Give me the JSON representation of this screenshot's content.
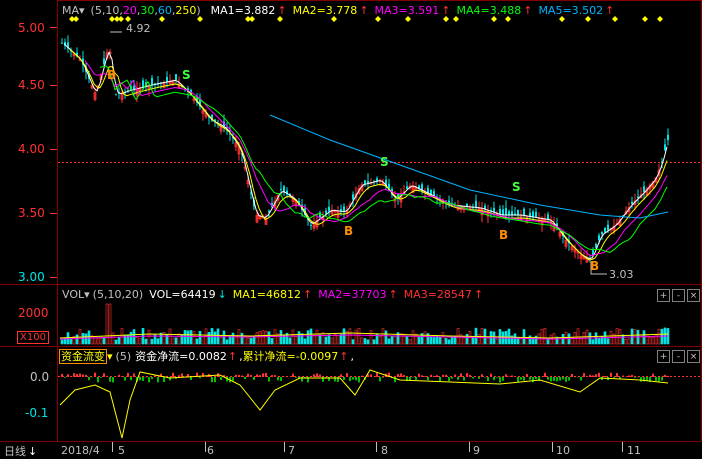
{
  "colors": {
    "up": "#ff3232",
    "down": "#00e4e4",
    "ma1": "#ffffff",
    "ma2": "#ffff00",
    "ma3": "#ff00ff",
    "ma4": "#00ff00",
    "ma5": "#00b4ff",
    "grid": "#800000",
    "text": "#c0c0c0",
    "cyan": "#00e4e4",
    "yellow": "#ffff00",
    "marker_b": "#ff8c00",
    "marker_s": "#40ff40"
  },
  "main": {
    "indicator": "MA",
    "params_prefix": "(5,10,",
    "params": [
      "20",
      "30",
      "60",
      "250"
    ],
    "params_suffix": ")",
    "ma1": "MA1=3.882",
    "ma2": "MA2=3.778",
    "ma3": "MA3=3.591",
    "ma4": "MA4=3.488",
    "ma5": "MA5=3.502",
    "arrow": "↑",
    "y_ticks": [
      "5.00",
      "4.50",
      "4.00",
      "3.50",
      "3.00"
    ],
    "high_label": "4.92",
    "low_label": "3.03",
    "buy": "B",
    "sell": "S"
  },
  "volume": {
    "indicator": "VOL",
    "params": "(5,10,20)",
    "vol": "VOL=64419",
    "vol_arrow": "↓",
    "ma1": "MA1=46812",
    "ma2": "MA2=37703",
    "ma3": "MA3=28547",
    "arrow": "↑",
    "y_tick": "2000",
    "unit": "X100"
  },
  "flow": {
    "indicator": "资金流变",
    "params": "(5)",
    "net": "资金净流=0.0082",
    "net_arrow": "↑",
    "cum": "累计净流=-0.0097",
    "cum_arrow": "↑",
    "sep": ",",
    "y_ticks": [
      "0.0",
      "-0.1"
    ]
  },
  "timeline": {
    "period": "日线",
    "period_icon": "arrow-down-icon",
    "labels": [
      "2018/4",
      "5",
      "6",
      "7",
      "8",
      "9",
      "10",
      "11"
    ]
  },
  "buttons": {
    "menu": "▾",
    "plus": "+",
    "minus": "-",
    "close": "×"
  }
}
